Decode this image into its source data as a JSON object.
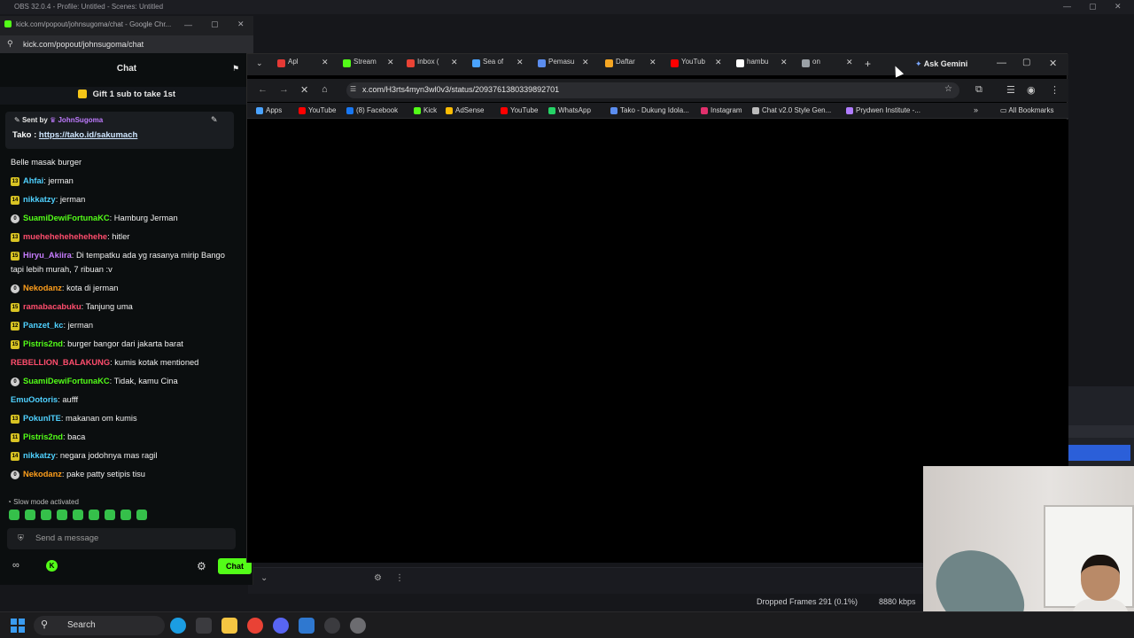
{
  "obs": {
    "title": "OBS 32.0.4 - Profile: Untitled - Scenes: Untitled",
    "status_dropped": "Dropped Frames 291 (0.1%)",
    "status_kbps": "8880 kbps"
  },
  "kick": {
    "window_title": "kick.com/popout/johnsugoma/chat - Google Chr...",
    "url": "kick.com/popout/johnsugoma/chat",
    "header": "Chat",
    "gift_banner": "Gift 1 sub to take 1st",
    "pinned": {
      "sent_by_label": "Sent by",
      "sent_by_user": "JohnSugoma",
      "tako_label": "Tako : ",
      "tako_link": "https://tako.id/sakumach"
    },
    "messages": [
      {
        "badge": "",
        "user": "",
        "user_color": "#ffffff",
        "text": "Belle masak burger"
      },
      {
        "badge": "13",
        "user": "Ahfai",
        "user_color": "#4fd1ff",
        "text": ": jerman"
      },
      {
        "badge": "14",
        "user": "nikkatzy",
        "user_color": "#4fd1ff",
        "text": ": jerman"
      },
      {
        "badge": "0",
        "user": "SuamiDewiFortunaKC",
        "user_color": "#53fc18",
        "text": ": Hamburg Jerman"
      },
      {
        "badge": "13",
        "user": "muehehehehehehehe",
        "user_color": "#ff4d6d",
        "text": ": hitler"
      },
      {
        "badge": "15",
        "user": "Hiryu_Akiira",
        "user_color": "#c77dff",
        "text": ": Di tempatku ada yg rasanya mirip Bango"
      },
      {
        "badge": "",
        "user": "",
        "user_color": "#ffffff",
        "text": "tapi lebih murah, 7 ribuan :v"
      },
      {
        "badge": "0",
        "user": "Nekodanz",
        "user_color": "#ff9f1c",
        "text": ": kota di jerman"
      },
      {
        "badge": "15",
        "user": "ramabacabuku",
        "user_color": "#ff4d6d",
        "text": ": Tanjung uma"
      },
      {
        "badge": "12",
        "user": "Panzet_kc",
        "user_color": "#4fd1ff",
        "text": ": jerman"
      },
      {
        "badge": "15",
        "user": "Pistris2nd",
        "user_color": "#53fc18",
        "text": ": burger bangor dari jakarta barat"
      },
      {
        "badge": "",
        "user": "REBELLION_BALAKUNG",
        "user_color": "#ff4d6d",
        "text": ": kumis kotak mentioned"
      },
      {
        "badge": "0",
        "user": "SuamiDewiFortunaKC",
        "user_color": "#53fc18",
        "text": ": Tidak, kamu Cina"
      },
      {
        "badge": "",
        "user": "EmuOotoris",
        "user_color": "#4fd1ff",
        "text": ": aufff"
      },
      {
        "badge": "13",
        "user": "PokunITE",
        "user_color": "#4fd1ff",
        "text": ": makanan om kumis"
      },
      {
        "badge": "11",
        "user": "Pistris2nd",
        "user_color": "#53fc18",
        "text": ": baca"
      },
      {
        "badge": "14",
        "user": "nikkatzy",
        "user_color": "#4fd1ff",
        "text": ": negara jodohnya mas ragil"
      },
      {
        "badge": "0",
        "user": "Nekodanz",
        "user_color": "#ff9f1c",
        "text": ": pake patty setipis tisu"
      }
    ],
    "slow_mode": "Slow mode activated",
    "send_placeholder": "Send a message",
    "chat_button": "Chat"
  },
  "browser": {
    "tabs": [
      {
        "label": "Apl",
        "color": "#e53935"
      },
      {
        "label": "Stream",
        "color": "#53fc18"
      },
      {
        "label": "Inbox (",
        "color": "#ea4335"
      },
      {
        "label": "Sea of",
        "color": "#4aa3ff"
      },
      {
        "label": "Pemasu",
        "color": "#5b8def"
      },
      {
        "label": "Daftar",
        "color": "#f5a623"
      },
      {
        "label": "YouTub",
        "color": "#ff0000"
      },
      {
        "label": "hambu",
        "color": "#ffffff"
      },
      {
        "label": "on",
        "color": "#9aa0a6"
      }
    ],
    "ask_gemini": "Ask Gemini",
    "url": "x.com/H3rts4myn3wl0v3/status/2093761380339892701",
    "bookmarks": [
      {
        "label": "Apps",
        "color": "#4aa3ff"
      },
      {
        "label": "YouTube",
        "color": "#ff0000"
      },
      {
        "label": "(8) Facebook",
        "color": "#1877f2"
      },
      {
        "label": "Kick",
        "color": "#53fc18"
      },
      {
        "label": "AdSense",
        "color": "#fbbc04"
      },
      {
        "label": "YouTube",
        "color": "#ff0000"
      },
      {
        "label": "WhatsApp",
        "color": "#25d366"
      },
      {
        "label": "Tako - Dukung Idola...",
        "color": "#5b8def"
      },
      {
        "label": "Instagram",
        "color": "#e1306c"
      },
      {
        "label": "Chat v2.0 Style Gen...",
        "color": "#bbbbbb"
      },
      {
        "label": "Prydwen Institute -...",
        "color": "#b07cff"
      }
    ],
    "all_bookmarks": "All Bookmarks"
  },
  "taskbar": {
    "search": "Search"
  }
}
